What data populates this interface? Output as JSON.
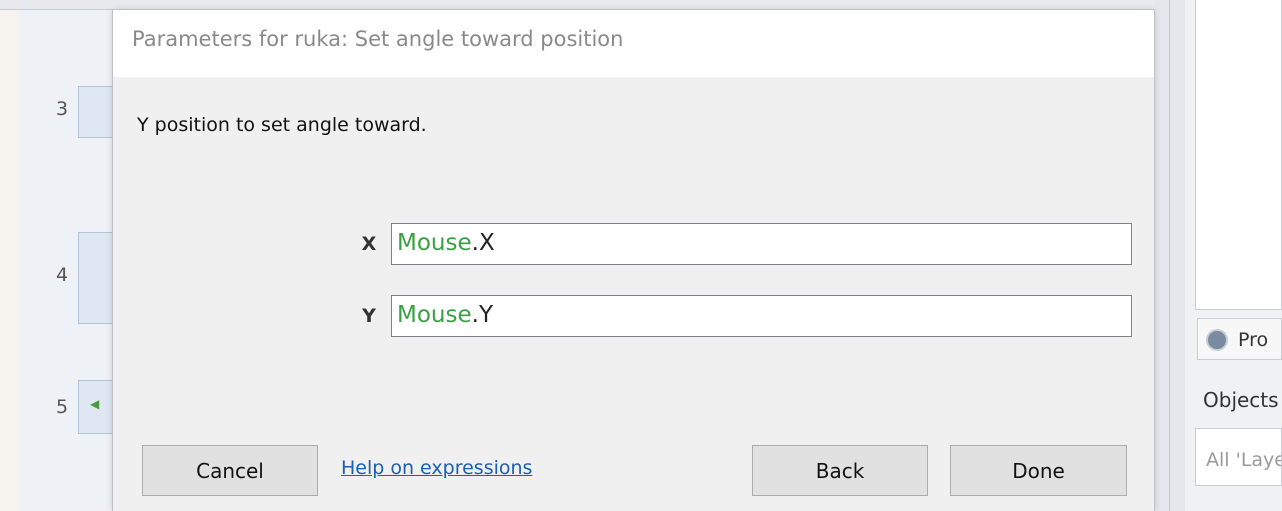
{
  "dialog": {
    "title": "Parameters for ruka: Set angle toward position",
    "description": "Y position to set angle toward.",
    "params": [
      {
        "label": "X",
        "object": "Mouse",
        "member": ".X"
      },
      {
        "label": "Y",
        "object": "Mouse",
        "member": ".Y"
      }
    ],
    "buttons": {
      "cancel": "Cancel",
      "help": "Help on expressions",
      "back": "Back",
      "done": "Done"
    }
  },
  "event_sheet": {
    "row_numbers": [
      "3",
      "4",
      "5"
    ],
    "sound_icon": "speaker-icon"
  },
  "right_panel": {
    "tab_label": "Pro",
    "tab_icon": "gear-icon",
    "section_title": "Objects",
    "search_placeholder": "All 'Layers'"
  },
  "colors": {
    "expression_object": "#3aa142",
    "link": "#1a5fb4"
  }
}
